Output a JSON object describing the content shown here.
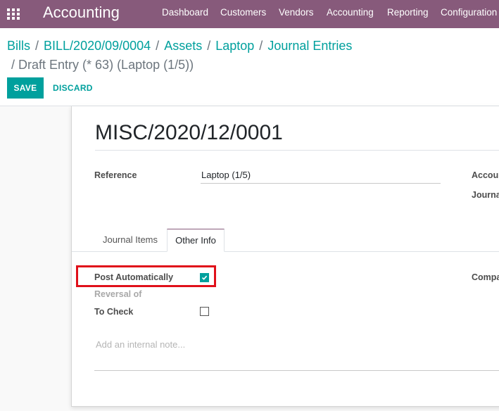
{
  "app": {
    "title": "Accounting"
  },
  "navbar": {
    "apps_icon": "apps-grid-icon",
    "menu": [
      "Dashboard",
      "Customers",
      "Vendors",
      "Accounting",
      "Reporting",
      "Configuration"
    ]
  },
  "breadcrumb": {
    "items": [
      "Bills",
      "BILL/2020/09/0004",
      "Assets",
      "Laptop",
      "Journal Entries"
    ],
    "separator": "/",
    "current": "Draft Entry (* 63) (Laptop (1/5))"
  },
  "buttons": {
    "save": "SAVE",
    "discard": "DISCARD"
  },
  "form": {
    "name": "MISC/2020/12/0001",
    "reference_label": "Reference",
    "reference_value": "Laptop (1/5)",
    "right_label_1": "Accou",
    "right_label_2": "Journa",
    "company_label": "Compa"
  },
  "tabs": [
    "Journal Items",
    "Other Info"
  ],
  "active_tab": "Other Info",
  "other_info": {
    "post_automatically_label": "Post Automatically",
    "post_automatically_checked": true,
    "reversal_of_label": "Reversal of",
    "to_check_label": "To Check",
    "to_check_checked": false,
    "note_placeholder": "Add an internal note..."
  },
  "colors": {
    "navbar": "#875a7b",
    "accent": "#00a09d",
    "highlight": "#e0101a"
  }
}
